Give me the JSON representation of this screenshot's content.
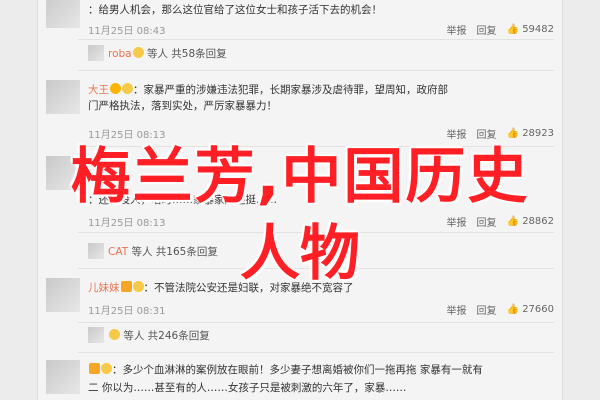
{
  "comments": [
    {
      "line1": "：给男人机会，那么这位官给了这位女士和孩子活下去的机会！",
      "meta": "11月25日 08:43",
      "actions": [
        "举报",
        "回复",
        "59482"
      ]
    },
    {
      "user": "roba",
      "line1": "等人 共58条回复",
      "meta": "",
      "actions": []
    },
    {
      "user": "大王",
      "line1": "：家暴严重的涉嫌违法犯罪，长期家暴涉及虐待罪，望周知，政府部",
      "line2": "门严格执法，落到实处，严厉家暴暴力！",
      "meta": "11月25日 08:13",
      "actions": [
        "举报",
        "回复",
        "28923"
      ]
    },
    {
      "user": "",
      "line1": "：还有没人，啥时……家暴家庭还挺……",
      "meta": "11月25日 08:13",
      "actions": [
        "举报",
        "回复",
        "28862"
      ]
    },
    {
      "user": "CAT",
      "line1": "等人 共165条回复",
      "meta": "",
      "actions": []
    },
    {
      "user": "儿妹妹",
      "line1": "：不管法院公安还是妇联，对家暴绝不宽容了",
      "meta": "11月25日 08:31",
      "actions": [
        "举报",
        "回复",
        "27660"
      ]
    },
    {
      "user": "",
      "line1": "等人 共246条回复",
      "meta": "",
      "actions": []
    },
    {
      "user": "",
      "line1": "：多少个血淋淋的案例放在眼前！多少妻子想离婚被你们一拖再拖 家暴有一就有",
      "line2": "二 你以为……甚至有的人……女孩子只是被刺激的六年了，家暴……",
      "meta": "",
      "actions": []
    }
  ],
  "overlay": {
    "line1": "梅兰芳,中国历史",
    "line2": "人物"
  },
  "colors": {
    "username": "#eb7350",
    "overlay": "#ff1f24"
  }
}
